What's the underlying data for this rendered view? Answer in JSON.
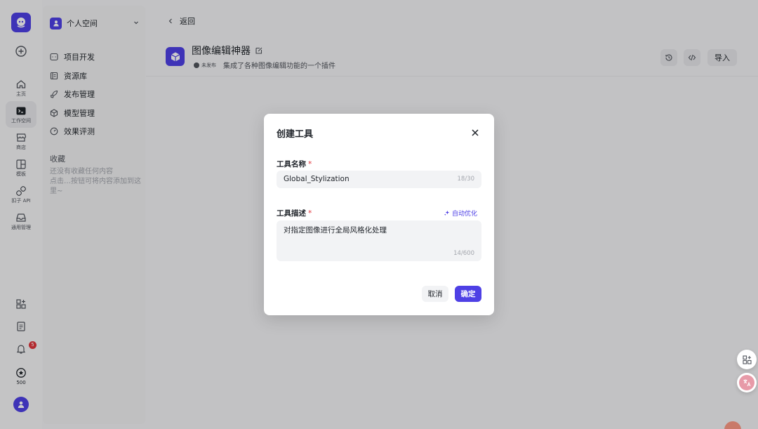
{
  "rail": {
    "items": [
      {
        "label": "主页",
        "icon": "home-icon"
      },
      {
        "label": "工作空间",
        "icon": "terminal-icon"
      },
      {
        "label": "商店",
        "icon": "store-icon"
      },
      {
        "label": "模板",
        "icon": "template-icon"
      },
      {
        "label": "扣子 API",
        "icon": "api-icon"
      },
      {
        "label": "通用管理",
        "icon": "inbox-icon"
      }
    ],
    "notification_count": "5",
    "points": "500"
  },
  "sidebar": {
    "space_label": "个人空间",
    "nav": [
      {
        "label": "项目开发",
        "icon": "project-icon"
      },
      {
        "label": "资源库",
        "icon": "library-icon"
      },
      {
        "label": "发布管理",
        "icon": "rocket-icon"
      },
      {
        "label": "模型管理",
        "icon": "cube-icon"
      },
      {
        "label": "效果评测",
        "icon": "gauge-icon"
      }
    ],
    "favorites_title": "收藏",
    "favorites_empty": "还没有收藏任何内容\n点击…按钮可将内容添加到这里~"
  },
  "main": {
    "back_label": "返回",
    "plugin_title": "图像编辑神器",
    "status": "未发布",
    "plugin_desc": "集成了各种图像编辑功能的一个插件",
    "import_label": "导入"
  },
  "dialog": {
    "title": "创建工具",
    "name_label": "工具名称",
    "name_value": "Global_Stylization",
    "name_count": "18/30",
    "desc_label": "工具描述",
    "auto_optimize": "自动优化",
    "desc_value": "对指定图像进行全局风格化处理",
    "desc_count": "14/600",
    "cancel_label": "取消",
    "ok_label": "确定",
    "required_mark": "*"
  },
  "colors": {
    "accent": "#4e40e5",
    "danger": "#e0353b"
  }
}
